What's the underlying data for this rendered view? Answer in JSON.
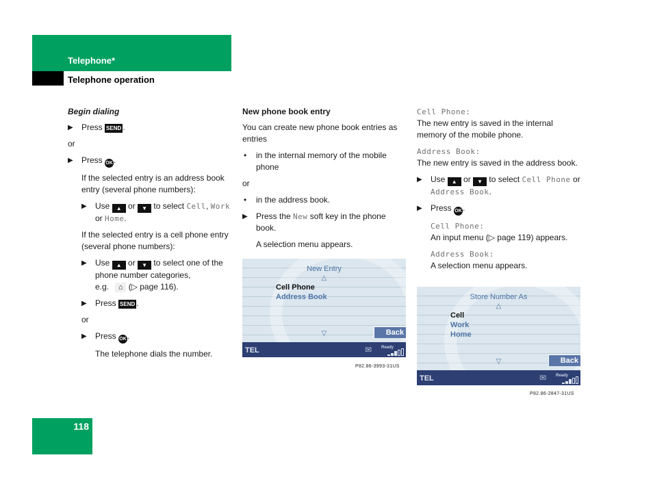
{
  "header": {
    "section": "Telephone*",
    "subsection": "Telephone operation"
  },
  "page_number": "118",
  "keys": {
    "send": "SEND",
    "ok": "OK",
    "up": "▲",
    "down": "▼",
    "step_marker": "▶",
    "bullet": "•",
    "home_icon": "⌂"
  },
  "col1": {
    "title": "Begin dialing",
    "press": "Press",
    "or": "or",
    "period": ".",
    "addr_entry_note": "If the selected entry is an address book entry (several phone numbers):",
    "use": "Use",
    "or_word": "or",
    "to_select": "to select",
    "cell": "Cell",
    "work": "Work",
    "home": "Home",
    "comma": ",",
    "cell_entry_note": "If the selected entry is a cell phone entry (several phone numbers):",
    "to_select_category": "to select one of the phone number categories,",
    "eg": "e.g.",
    "page_ref": "(▷ page 116).",
    "dials": "The telephone dials the number."
  },
  "col2": {
    "title": "New phone book entry",
    "intro": "You can create new phone book entries as entries",
    "bullet1": "in the internal memory of the mobile phone",
    "or": "or",
    "bullet2": "in the address book.",
    "press_the": "Press the",
    "new_key": "New",
    "soft_key_text": "soft key in the phone book.",
    "result": "A selection menu appears."
  },
  "col3": {
    "cell_phone_label": "Cell Phone:",
    "cell_phone_desc": "The new entry is saved in the internal memory of the mobile phone.",
    "address_book_label": "Address Book:",
    "address_book_desc": "The new entry is saved in the address book.",
    "use": "Use",
    "or_word": "or",
    "to_select": "to select",
    "cell_phone": "Cell Phone",
    "address_book": "Address Book",
    "press": "Press",
    "cell_phone_result_label": "Cell Phone:",
    "cell_phone_result": "An input menu (▷ page 119) appears.",
    "address_book_result_label": "Address Book:",
    "address_book_result": "A selection menu appears."
  },
  "screen1": {
    "title": "New Entry",
    "up_arrow": "△",
    "items": [
      {
        "label": "Cell Phone",
        "selected": true
      },
      {
        "label": "Address Book",
        "selected": false
      }
    ],
    "down_arrow": "▽",
    "back": "Back",
    "status_label": "TEL",
    "envelope_icon": "✉",
    "ready": "Ready",
    "signal_level": "3/5",
    "caption": "P82.86-3993-31US"
  },
  "screen2": {
    "title": "Store Number As",
    "up_arrow": "△",
    "items": [
      {
        "label": "Cell",
        "selected": true
      },
      {
        "label": "Work",
        "selected": false
      },
      {
        "label": "Home",
        "selected": false
      }
    ],
    "down_arrow": "▽",
    "back": "Back",
    "status_label": "TEL",
    "envelope_icon": "✉",
    "ready": "Ready",
    "signal_level": "3/5",
    "caption": "P82.86-2847-31US"
  }
}
